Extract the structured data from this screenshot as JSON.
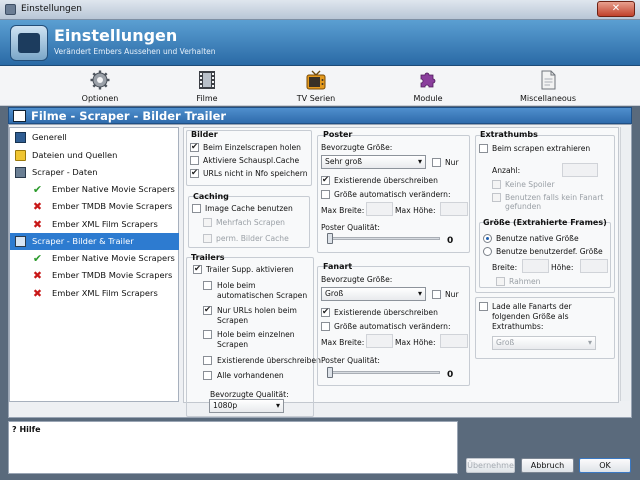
{
  "window": {
    "title": "Einstellungen",
    "close": "✕"
  },
  "header": {
    "title": "Einstellungen",
    "subtitle": "Verändert Embers Aussehen und Verhalten"
  },
  "toolbar": [
    {
      "label": "Optionen",
      "icon": "gear-icon"
    },
    {
      "label": "Filme",
      "icon": "film-icon"
    },
    {
      "label": "TV Serien",
      "icon": "tv-icon"
    },
    {
      "label": "Module",
      "icon": "puzzle-icon"
    },
    {
      "label": "Miscellaneous",
      "icon": "document-icon"
    }
  ],
  "section": {
    "title": "Filme - Scraper - Bilder  Trailer"
  },
  "tree": [
    {
      "label": "Generell",
      "icon": "book-icon"
    },
    {
      "label": "Dateien und Quellen",
      "icon": "folder-icon"
    },
    {
      "label": "Scraper - Daten",
      "icon": "scraper-icon"
    },
    {
      "label": "Ember Native Movie Scrapers",
      "icon": "check-icon"
    },
    {
      "label": "Ember TMDB Movie Scrapers",
      "icon": "x-icon"
    },
    {
      "label": "Ember XML Film Scrapers",
      "icon": "x-icon"
    },
    {
      "label": "Scraper - Bilder & Trailer",
      "icon": "scraper-icon"
    },
    {
      "label": "Ember Native Movie Scrapers",
      "icon": "check-icon"
    },
    {
      "label": "Ember TMDB Movie Scrapers",
      "icon": "x-icon"
    },
    {
      "label": "Ember XML Film Scrapers",
      "icon": "x-icon"
    }
  ],
  "bilder": {
    "title": "Bilder",
    "opt1": "Beim Einzelscrapen holen",
    "opt2": "Aktiviere Schauspl.Cache",
    "opt3": "URLs nicht in Nfo speichern"
  },
  "caching": {
    "title": "Caching",
    "opt1": "Image Cache benutzen",
    "opt2": "Mehrfach Scrapen",
    "opt3": "perm. Bilder Cache"
  },
  "trailers": {
    "title": "Trailers",
    "opt1": "Trailer Supp. aktivieren",
    "opt2a": "Hole beim",
    "opt2b": "automatischen Scrapen",
    "opt3a": "Nur URLs holen beim",
    "opt3b": "Scrapen",
    "opt4a": "Hole beim einzelnen",
    "opt4b": "Scrapen",
    "opt5": "Existierende überschreiben",
    "opt6": "Alle vorhandenen",
    "quality_label": "Bevorzugte Qualität:",
    "quality_value": "1080p"
  },
  "poster": {
    "title": "Poster",
    "size_label": "Bevorzugte Größe:",
    "size_value": "Sehr groß",
    "only": "Nur",
    "overwrite": "Existierende überschreiben",
    "resize": "Größe automatisch verändern:",
    "max_width": "Max Breite:",
    "max_height": "Max Höhe:",
    "quality": "Poster Qualität:",
    "quality_value": "0"
  },
  "fanart": {
    "title": "Fanart",
    "size_label": "Bevorzugte Größe:",
    "size_value": "Groß",
    "only": "Nur",
    "overwrite": "Existierende überschreiben",
    "resize": "Größe automatisch verändern:",
    "max_width": "Max Breite:",
    "max_height": "Max Höhe:",
    "quality": "Poster Qualität:",
    "quality_value": "0"
  },
  "extrathumbs": {
    "title": "Extrathumbs",
    "opt1": "Beim scrapen extrahieren",
    "count_label": "Anzahl:",
    "opt2": "Keine Spoiler",
    "opt3a": "Benutzen falls kein Fanart",
    "opt3b": "gefunden"
  },
  "frames": {
    "title": "Größe (Extrahierte Frames)",
    "radio1": "Benutze native Größe",
    "radio2": "Benutze benutzerdef. Größe",
    "width_label": "Breite:",
    "height_label": "Höhe:",
    "frame": "Rahmen"
  },
  "fanarts": {
    "opt1a": "Lade alle Fanarts der",
    "opt1b": "folgenden Größe als",
    "opt1c": "Extrathumbs:",
    "value": "Groß"
  },
  "help": {
    "label": "Hilfe"
  },
  "buttons": {
    "apply": "Übernehme",
    "cancel": "Abbruch",
    "ok": "OK"
  }
}
